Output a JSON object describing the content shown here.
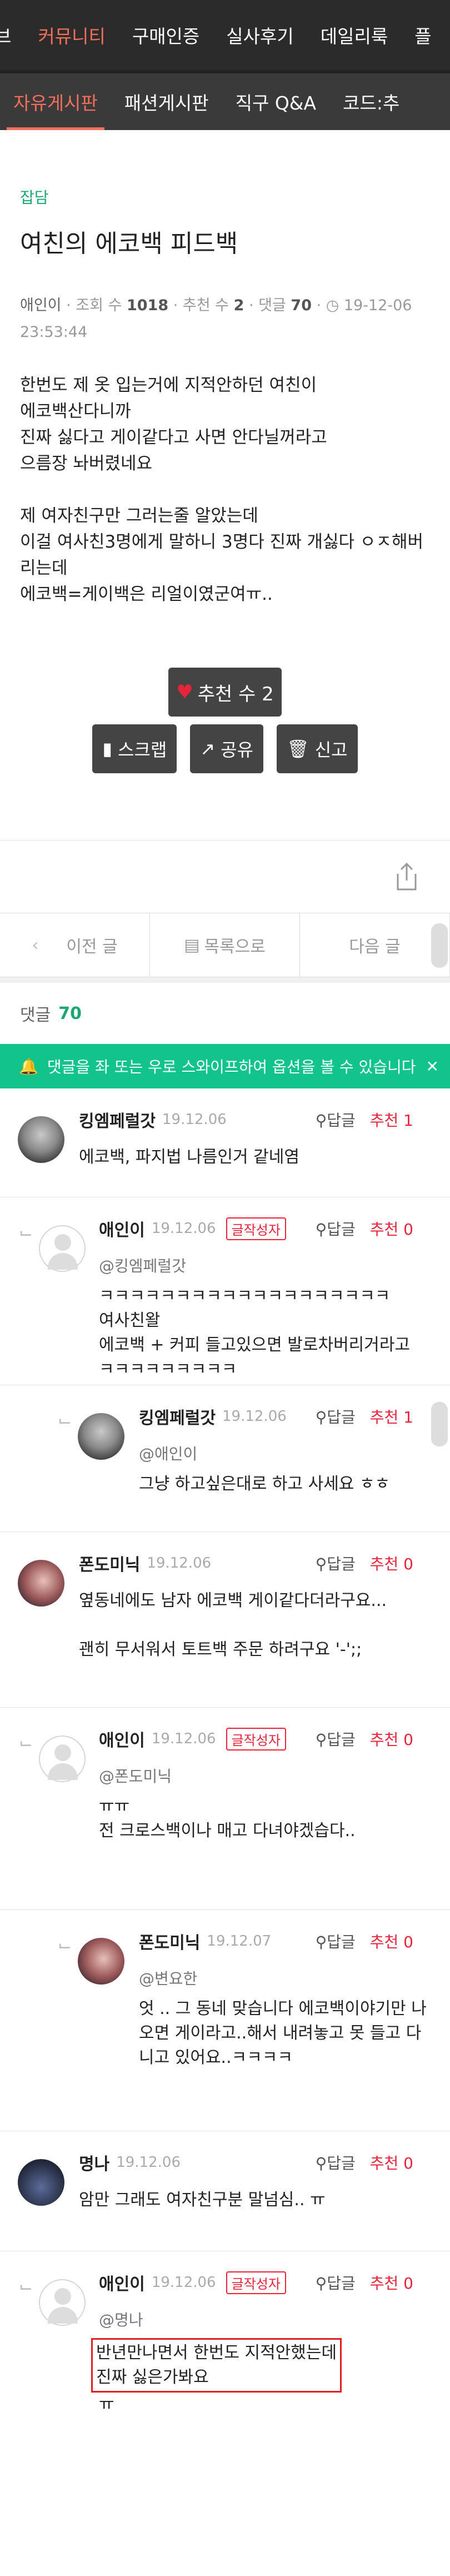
{
  "top_tabs": [
    "브",
    "커뮤니티",
    "구매인증",
    "실사후기",
    "데일리룩",
    "플"
  ],
  "sub_tabs": [
    "자유게시판",
    "패션게시판",
    "직구 Q&A",
    "코드:추"
  ],
  "post": {
    "category": "잡담",
    "title": "여친의 에코백 피드백",
    "author": "애인이",
    "views_label": "조회 수",
    "views": "1018",
    "recs_label": "추천 수",
    "recs": "2",
    "comments_label": "댓글",
    "comments": "70",
    "datetime": "19-12-06 23:53:44",
    "body": "한번도 제 옷 입는거에 지적안하던 여친이\n에코백산다니까\n진짜 싫다고 게이같다고 사면 안다닐꺼라고\n으름장 놔버렸네요\n\n제 여자친구만 그러는줄 알았는데\n이걸 여사친3명에게 말하니 3명다 진짜 개싫다 ㅇㅈ해버리는데\n에코백=게이백은 리얼이였군여ㅠ..",
    "vote_label": "추천 수 2",
    "scrap": "스크랩",
    "share": "공유",
    "report": "신고"
  },
  "pager": {
    "prev": "이전 글",
    "list": "목록으로",
    "next": "다음 글"
  },
  "comments_header": {
    "label": "댓글",
    "count": "70"
  },
  "notice": "댓글을 좌 또는 우로 스와이프하여 옵션을 볼 수 있습니다",
  "reply_label": "답글",
  "rec_prefix": "추천",
  "writer_badge": "글작성자",
  "comments": [
    {
      "name": "킹엠페럴갓",
      "date": "19.12.06",
      "rec": "1",
      "text": "에코백, 파지법 나름인거 같네염"
    },
    {
      "name": "애인이",
      "date": "19.12.06",
      "rec": "0",
      "mention": "@킹엠페럴갓",
      "text": "ㅋㅋㅋㅋㅋㅋㅋㅋㅋㅋㅋㅋㅋㅋㅋㅋㅋㅋㅋ\n여사친왈\n에코백 + 커피 들고있으면 발로차버리거라고\nㅋㅋㅋㅋㅋㅋㅋㅋㅋ"
    },
    {
      "name": "킹엠페럴갓",
      "date": "19.12.06",
      "rec": "1",
      "mention": "@애인이",
      "text": "그냥 하고싶은대로 하고 사세요 ㅎㅎ"
    },
    {
      "name": "폰도미닉",
      "date": "19.12.06",
      "rec": "0",
      "text": "옆동네에도 남자 에코백 게이같다더라구요...\n\n괜히 무서워서 토트백 주문 하려구요 '-';;"
    },
    {
      "name": "애인이",
      "date": "19.12.06",
      "rec": "0",
      "mention": "@폰도미닉",
      "text": "ㅠㅠ\n전 크로스백이나 매고 다녀야겠습다.."
    },
    {
      "name": "폰도미닉",
      "date": "19.12.07",
      "rec": "0",
      "mention": "@변요한",
      "text": "엇 .. 그 동네 맞습니다 에코백이야기만 나오면 게이라고..해서 내려놓고 못 들고 다니고 있어요..ㅋㅋㅋㅋ"
    },
    {
      "name": "명나",
      "date": "19.12.06",
      "rec": "0",
      "text": "암만 그래도 여자친구분 말넘심.. ㅠ"
    },
    {
      "name": "애인이",
      "date": "19.12.06",
      "rec": "0",
      "mention": "@명나",
      "text": "반년만나면서 한번도 지적안했는데\n진짜 싫은가봐요",
      "tail": "ㅠ"
    }
  ]
}
